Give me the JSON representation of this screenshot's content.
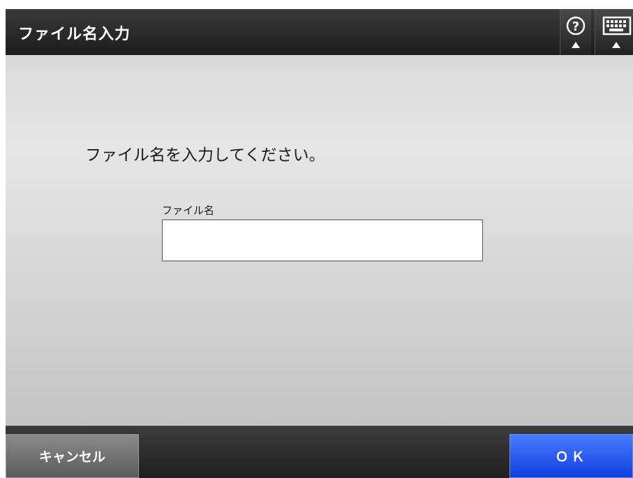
{
  "header": {
    "title": "ファイル名入力",
    "help_icon": "help-question-icon",
    "keyboard_icon": "keyboard-icon"
  },
  "main": {
    "instruction": "ファイル名を入力してください。",
    "field_label": "ファイル名",
    "field_value": "",
    "field_placeholder": ""
  },
  "footer": {
    "cancel_label": "キャンセル",
    "ok_label": "ＯＫ"
  },
  "colors": {
    "header_bg": "#1c1c1c",
    "ok_button": "#1f4ff0",
    "cancel_button": "#6e6e6e"
  }
}
